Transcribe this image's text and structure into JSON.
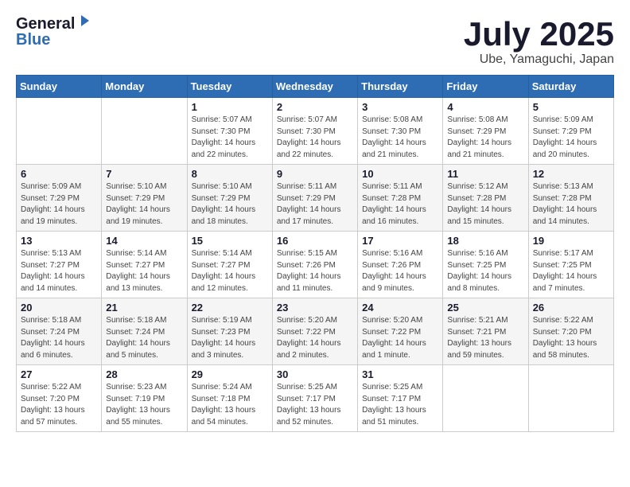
{
  "logo": {
    "general": "General",
    "blue": "Blue"
  },
  "title": {
    "month": "July 2025",
    "location": "Ube, Yamaguchi, Japan"
  },
  "weekdays": [
    "Sunday",
    "Monday",
    "Tuesday",
    "Wednesday",
    "Thursday",
    "Friday",
    "Saturday"
  ],
  "weeks": [
    [
      {
        "day": "",
        "detail": ""
      },
      {
        "day": "",
        "detail": ""
      },
      {
        "day": "1",
        "detail": "Sunrise: 5:07 AM\nSunset: 7:30 PM\nDaylight: 14 hours and 22 minutes."
      },
      {
        "day": "2",
        "detail": "Sunrise: 5:07 AM\nSunset: 7:30 PM\nDaylight: 14 hours and 22 minutes."
      },
      {
        "day": "3",
        "detail": "Sunrise: 5:08 AM\nSunset: 7:30 PM\nDaylight: 14 hours and 21 minutes."
      },
      {
        "day": "4",
        "detail": "Sunrise: 5:08 AM\nSunset: 7:29 PM\nDaylight: 14 hours and 21 minutes."
      },
      {
        "day": "5",
        "detail": "Sunrise: 5:09 AM\nSunset: 7:29 PM\nDaylight: 14 hours and 20 minutes."
      }
    ],
    [
      {
        "day": "6",
        "detail": "Sunrise: 5:09 AM\nSunset: 7:29 PM\nDaylight: 14 hours and 19 minutes."
      },
      {
        "day": "7",
        "detail": "Sunrise: 5:10 AM\nSunset: 7:29 PM\nDaylight: 14 hours and 19 minutes."
      },
      {
        "day": "8",
        "detail": "Sunrise: 5:10 AM\nSunset: 7:29 PM\nDaylight: 14 hours and 18 minutes."
      },
      {
        "day": "9",
        "detail": "Sunrise: 5:11 AM\nSunset: 7:29 PM\nDaylight: 14 hours and 17 minutes."
      },
      {
        "day": "10",
        "detail": "Sunrise: 5:11 AM\nSunset: 7:28 PM\nDaylight: 14 hours and 16 minutes."
      },
      {
        "day": "11",
        "detail": "Sunrise: 5:12 AM\nSunset: 7:28 PM\nDaylight: 14 hours and 15 minutes."
      },
      {
        "day": "12",
        "detail": "Sunrise: 5:13 AM\nSunset: 7:28 PM\nDaylight: 14 hours and 14 minutes."
      }
    ],
    [
      {
        "day": "13",
        "detail": "Sunrise: 5:13 AM\nSunset: 7:27 PM\nDaylight: 14 hours and 14 minutes."
      },
      {
        "day": "14",
        "detail": "Sunrise: 5:14 AM\nSunset: 7:27 PM\nDaylight: 14 hours and 13 minutes."
      },
      {
        "day": "15",
        "detail": "Sunrise: 5:14 AM\nSunset: 7:27 PM\nDaylight: 14 hours and 12 minutes."
      },
      {
        "day": "16",
        "detail": "Sunrise: 5:15 AM\nSunset: 7:26 PM\nDaylight: 14 hours and 11 minutes."
      },
      {
        "day": "17",
        "detail": "Sunrise: 5:16 AM\nSunset: 7:26 PM\nDaylight: 14 hours and 9 minutes."
      },
      {
        "day": "18",
        "detail": "Sunrise: 5:16 AM\nSunset: 7:25 PM\nDaylight: 14 hours and 8 minutes."
      },
      {
        "day": "19",
        "detail": "Sunrise: 5:17 AM\nSunset: 7:25 PM\nDaylight: 14 hours and 7 minutes."
      }
    ],
    [
      {
        "day": "20",
        "detail": "Sunrise: 5:18 AM\nSunset: 7:24 PM\nDaylight: 14 hours and 6 minutes."
      },
      {
        "day": "21",
        "detail": "Sunrise: 5:18 AM\nSunset: 7:24 PM\nDaylight: 14 hours and 5 minutes."
      },
      {
        "day": "22",
        "detail": "Sunrise: 5:19 AM\nSunset: 7:23 PM\nDaylight: 14 hours and 3 minutes."
      },
      {
        "day": "23",
        "detail": "Sunrise: 5:20 AM\nSunset: 7:22 PM\nDaylight: 14 hours and 2 minutes."
      },
      {
        "day": "24",
        "detail": "Sunrise: 5:20 AM\nSunset: 7:22 PM\nDaylight: 14 hours and 1 minute."
      },
      {
        "day": "25",
        "detail": "Sunrise: 5:21 AM\nSunset: 7:21 PM\nDaylight: 13 hours and 59 minutes."
      },
      {
        "day": "26",
        "detail": "Sunrise: 5:22 AM\nSunset: 7:20 PM\nDaylight: 13 hours and 58 minutes."
      }
    ],
    [
      {
        "day": "27",
        "detail": "Sunrise: 5:22 AM\nSunset: 7:20 PM\nDaylight: 13 hours and 57 minutes."
      },
      {
        "day": "28",
        "detail": "Sunrise: 5:23 AM\nSunset: 7:19 PM\nDaylight: 13 hours and 55 minutes."
      },
      {
        "day": "29",
        "detail": "Sunrise: 5:24 AM\nSunset: 7:18 PM\nDaylight: 13 hours and 54 minutes."
      },
      {
        "day": "30",
        "detail": "Sunrise: 5:25 AM\nSunset: 7:17 PM\nDaylight: 13 hours and 52 minutes."
      },
      {
        "day": "31",
        "detail": "Sunrise: 5:25 AM\nSunset: 7:17 PM\nDaylight: 13 hours and 51 minutes."
      },
      {
        "day": "",
        "detail": ""
      },
      {
        "day": "",
        "detail": ""
      }
    ]
  ]
}
